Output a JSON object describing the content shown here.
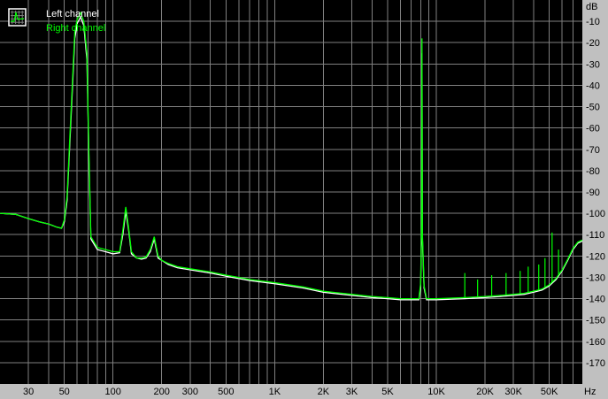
{
  "chart_data": {
    "type": "line",
    "title": "",
    "xlabel": "",
    "ylabel": "",
    "x_unit": "Hz",
    "y_unit": "dB",
    "x_scale": "log",
    "xlim": [
      20,
      80000
    ],
    "ylim": [
      -180,
      0
    ],
    "grid": true,
    "legend_position": "top-left",
    "background": "#000000",
    "grid_color": "#808080",
    "x_ticks": [
      {
        "value": 30,
        "label": "30"
      },
      {
        "value": 50,
        "label": "50"
      },
      {
        "value": 100,
        "label": "100"
      },
      {
        "value": 200,
        "label": "200"
      },
      {
        "value": 300,
        "label": "300"
      },
      {
        "value": 500,
        "label": "500"
      },
      {
        "value": 1000,
        "label": "1K"
      },
      {
        "value": 2000,
        "label": "2K"
      },
      {
        "value": 3000,
        "label": "3K"
      },
      {
        "value": 5000,
        "label": "5K"
      },
      {
        "value": 10000,
        "label": "10K"
      },
      {
        "value": 20000,
        "label": "20K"
      },
      {
        "value": 30000,
        "label": "30K"
      },
      {
        "value": 50000,
        "label": "50K"
      }
    ],
    "y_ticks": [
      -10,
      -20,
      -30,
      -40,
      -50,
      -60,
      -70,
      -80,
      -90,
      -100,
      -110,
      -120,
      -130,
      -140,
      -150,
      -160,
      -170
    ],
    "series": [
      {
        "name": "Left channel",
        "color": "#ffffff",
        "points": [
          [
            20,
            -100
          ],
          [
            25,
            -100.5
          ],
          [
            30,
            -102.5
          ],
          [
            35,
            -104
          ],
          [
            40,
            -105
          ],
          [
            45,
            -106.5
          ],
          [
            48,
            -107
          ],
          [
            50,
            -104
          ],
          [
            52,
            -94
          ],
          [
            55,
            -55
          ],
          [
            58,
            -18
          ],
          [
            60,
            -11
          ],
          [
            63,
            -8
          ],
          [
            66,
            -12
          ],
          [
            69,
            -28
          ],
          [
            71,
            -75
          ],
          [
            73,
            -112
          ],
          [
            80,
            -117
          ],
          [
            90,
            -118
          ],
          [
            100,
            -119
          ],
          [
            110,
            -118.5
          ],
          [
            115,
            -110
          ],
          [
            120,
            -99
          ],
          [
            125,
            -108
          ],
          [
            130,
            -119
          ],
          [
            140,
            -121
          ],
          [
            150,
            -121.5
          ],
          [
            160,
            -121
          ],
          [
            170,
            -118
          ],
          [
            180,
            -112
          ],
          [
            190,
            -121
          ],
          [
            200,
            -122
          ],
          [
            220,
            -124
          ],
          [
            250,
            -125.5
          ],
          [
            300,
            -126.5
          ],
          [
            400,
            -128
          ],
          [
            500,
            -129.5
          ],
          [
            700,
            -131.5
          ],
          [
            1000,
            -133
          ],
          [
            1500,
            -135
          ],
          [
            2000,
            -137
          ],
          [
            3000,
            -138.5
          ],
          [
            4000,
            -139.5
          ],
          [
            5000,
            -140
          ],
          [
            6000,
            -140.5
          ],
          [
            7000,
            -140.5
          ],
          [
            7800,
            -140.5
          ],
          [
            8000,
            -135
          ],
          [
            8100,
            -110
          ],
          [
            8150,
            -25
          ],
          [
            8200,
            -112
          ],
          [
            8400,
            -135
          ],
          [
            8700,
            -140.5
          ],
          [
            10000,
            -140.5
          ],
          [
            15000,
            -140
          ],
          [
            20000,
            -139.5
          ],
          [
            25000,
            -139
          ],
          [
            30000,
            -138.5
          ],
          [
            35000,
            -138
          ],
          [
            40000,
            -137
          ],
          [
            45000,
            -136
          ],
          [
            50000,
            -134
          ],
          [
            55000,
            -131
          ],
          [
            60000,
            -127
          ],
          [
            65000,
            -122
          ],
          [
            70000,
            -117
          ],
          [
            75000,
            -114
          ],
          [
            80000,
            -113
          ]
        ]
      },
      {
        "name": "Right channel",
        "color": "#00ff00",
        "points": [
          [
            20,
            -100
          ],
          [
            25,
            -100.5
          ],
          [
            30,
            -102.5
          ],
          [
            35,
            -104
          ],
          [
            40,
            -105
          ],
          [
            45,
            -106.5
          ],
          [
            48,
            -107
          ],
          [
            50,
            -103
          ],
          [
            52,
            -92
          ],
          [
            55,
            -52
          ],
          [
            58,
            -15
          ],
          [
            60,
            -9
          ],
          [
            63,
            -6
          ],
          [
            66,
            -10
          ],
          [
            69,
            -25
          ],
          [
            71,
            -72
          ],
          [
            73,
            -111
          ],
          [
            80,
            -116
          ],
          [
            90,
            -117
          ],
          [
            100,
            -118
          ],
          [
            110,
            -118
          ],
          [
            115,
            -108
          ],
          [
            120,
            -97
          ],
          [
            125,
            -107
          ],
          [
            130,
            -118
          ],
          [
            140,
            -121
          ],
          [
            150,
            -121
          ],
          [
            160,
            -120.5
          ],
          [
            170,
            -117
          ],
          [
            180,
            -111
          ],
          [
            190,
            -120
          ],
          [
            200,
            -122
          ],
          [
            220,
            -123.5
          ],
          [
            250,
            -125
          ],
          [
            300,
            -126
          ],
          [
            400,
            -127.5
          ],
          [
            500,
            -129
          ],
          [
            700,
            -131
          ],
          [
            1000,
            -132.5
          ],
          [
            1500,
            -134.5
          ],
          [
            2000,
            -136.5
          ],
          [
            3000,
            -138
          ],
          [
            4000,
            -139
          ],
          [
            5000,
            -139.5
          ],
          [
            6000,
            -140
          ],
          [
            7000,
            -140
          ],
          [
            7800,
            -140
          ],
          [
            8000,
            -133
          ],
          [
            8100,
            -105
          ],
          [
            8150,
            -18
          ],
          [
            8200,
            -110
          ],
          [
            8400,
            -134
          ],
          [
            8700,
            -140
          ],
          [
            10000,
            -140
          ],
          [
            15000,
            -139.5
          ],
          [
            20000,
            -139
          ],
          [
            25000,
            -138.5
          ],
          [
            30000,
            -138
          ],
          [
            35000,
            -137.5
          ],
          [
            40000,
            -136.5
          ],
          [
            45000,
            -135.5
          ],
          [
            50000,
            -133.5
          ],
          [
            55000,
            -130.5
          ],
          [
            60000,
            -126.5
          ],
          [
            65000,
            -121.5
          ],
          [
            70000,
            -116.5
          ],
          [
            75000,
            -113.5
          ],
          [
            80000,
            -112.5
          ]
        ]
      }
    ],
    "spikes": [
      {
        "x": 15000,
        "y": -128
      },
      {
        "x": 18000,
        "y": -131
      },
      {
        "x": 22000,
        "y": -129
      },
      {
        "x": 27000,
        "y": -128
      },
      {
        "x": 33000,
        "y": -127
      },
      {
        "x": 37000,
        "y": -125
      },
      {
        "x": 43000,
        "y": -124
      },
      {
        "x": 47000,
        "y": -121
      },
      {
        "x": 52000,
        "y": -109
      },
      {
        "x": 57000,
        "y": -117
      }
    ]
  }
}
